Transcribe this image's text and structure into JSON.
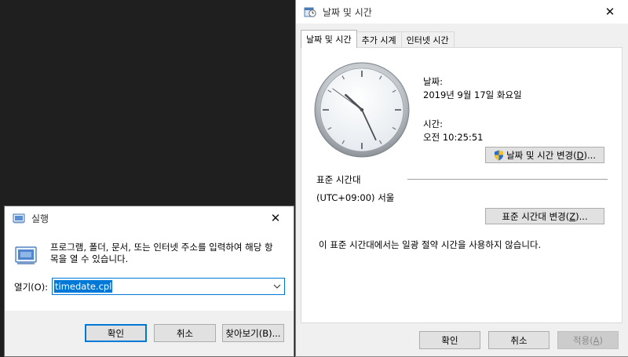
{
  "datetime_window": {
    "title": "날짜 및 시간",
    "close_glyph": "✕",
    "tabs": [
      {
        "label": "날짜 및 시간",
        "active": true
      },
      {
        "label": "추가 시계",
        "active": false
      },
      {
        "label": "인터넷 시간",
        "active": false
      }
    ],
    "clock": {
      "hour": 10,
      "minute": 25,
      "second": 51
    },
    "date_label": "날짜:",
    "date_value": "2019년 9월 17일 화요일",
    "time_label": "시간:",
    "time_value": "오전 10:25:51",
    "change_datetime_button": {
      "label": "날짜 및 시간 변경(",
      "key": "D",
      "suffix": ")..."
    },
    "timezone_section_label": "표준 시간대",
    "timezone_value": "(UTC+09:00) 서울",
    "change_timezone_button": {
      "label": "표준 시간대 변경(",
      "key": "Z",
      "suffix": ")..."
    },
    "dst_note": "이 표준 시간대에서는 일광 절약 시간을 사용하지 않습니다.",
    "ok_label": "확인",
    "cancel_label": "취소",
    "apply_button": {
      "label": "적용(",
      "key": "A",
      "suffix": ")"
    }
  },
  "run_dialog": {
    "title": "실행",
    "close_glyph": "✕",
    "description": "프로그램, 폴더, 문서, 또는 인터넷 주소를 입력하여 해당 항\n목을 열 수 있습니다.",
    "open_label": "열기(O):",
    "input_value": "timedate.cpl",
    "dropdown_glyph": "⌵",
    "ok_label": "확인",
    "cancel_label": "취소",
    "browse_label": "찾아보기(B)..."
  },
  "colors": {
    "accent": "#0078d7",
    "desktop": "#1f1f1f",
    "dialog_bg": "#f0f0f0"
  },
  "icons": [
    "datetime-app-icon",
    "shield-icon",
    "run-app-icon",
    "run-large-icon",
    "close-icon",
    "chevron-down-icon"
  ]
}
